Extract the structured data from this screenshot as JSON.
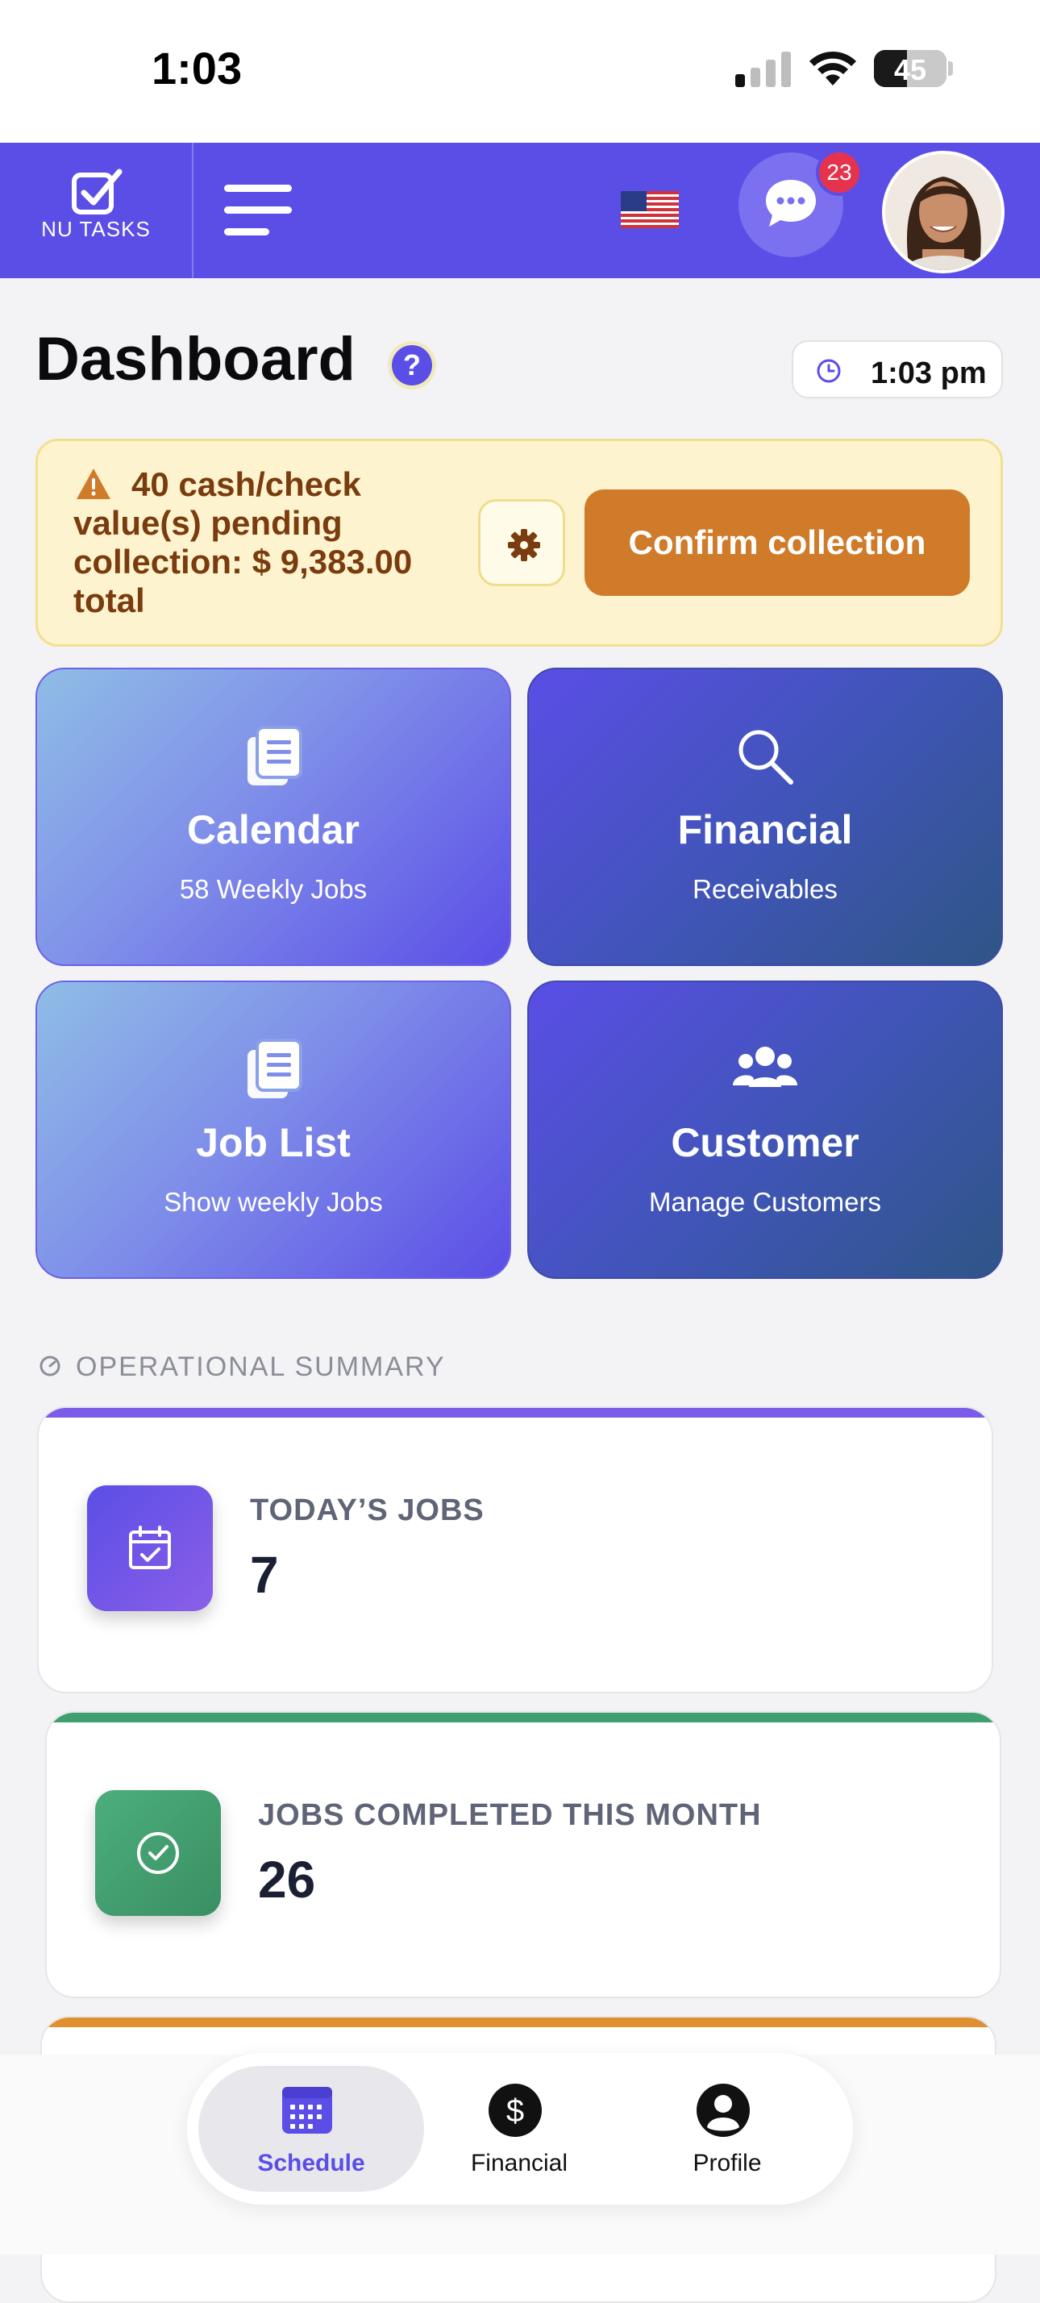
{
  "status_bar": {
    "time": "1:03",
    "battery": "45"
  },
  "header": {
    "logo_text": "NU TASKS",
    "chat_badge_count": "23",
    "colors": {
      "brand": "#5b4ee6",
      "badge": "#e6334d"
    }
  },
  "dashboard": {
    "title": "Dashboard",
    "help": "?",
    "time_chip": "1:03 pm"
  },
  "alert": {
    "message": "40 cash/check value(s) pending collection: $ 9,383.00 total",
    "confirm_label": "Confirm collection",
    "colors": {
      "bg": "#fdf4cf",
      "text": "#7a3c0e",
      "button": "#cf7b2a"
    }
  },
  "tiles": [
    {
      "title": "Calendar",
      "subtitle": "58 Weekly Jobs",
      "icon": "copy-list-icon"
    },
    {
      "title": "Financial",
      "subtitle": "Receivables",
      "icon": "search-icon"
    },
    {
      "title": "Job List",
      "subtitle": "Show weekly Jobs",
      "icon": "copy-list-icon"
    },
    {
      "title": "Customer",
      "subtitle": "Manage Customers",
      "icon": "users-icon"
    }
  ],
  "summary": {
    "section_label": "OPERATIONAL SUMMARY",
    "cards": [
      {
        "label": "TODAY’S JOBS",
        "value": "7",
        "color": "#6a5ae8",
        "icon": "calendar-check-icon"
      },
      {
        "label": "JOBS COMPLETED THIS MONTH",
        "value": "26",
        "color": "#3f9f6e",
        "icon": "check-circle-icon"
      }
    ],
    "partial_card_color": "#e09030"
  },
  "bottom_nav": {
    "items": [
      {
        "label": "Schedule",
        "icon": "calendar-grid-icon",
        "active": true
      },
      {
        "label": "Financial",
        "icon": "dollar-icon",
        "active": false
      },
      {
        "label": "Profile",
        "icon": "user-icon",
        "active": false
      }
    ]
  }
}
